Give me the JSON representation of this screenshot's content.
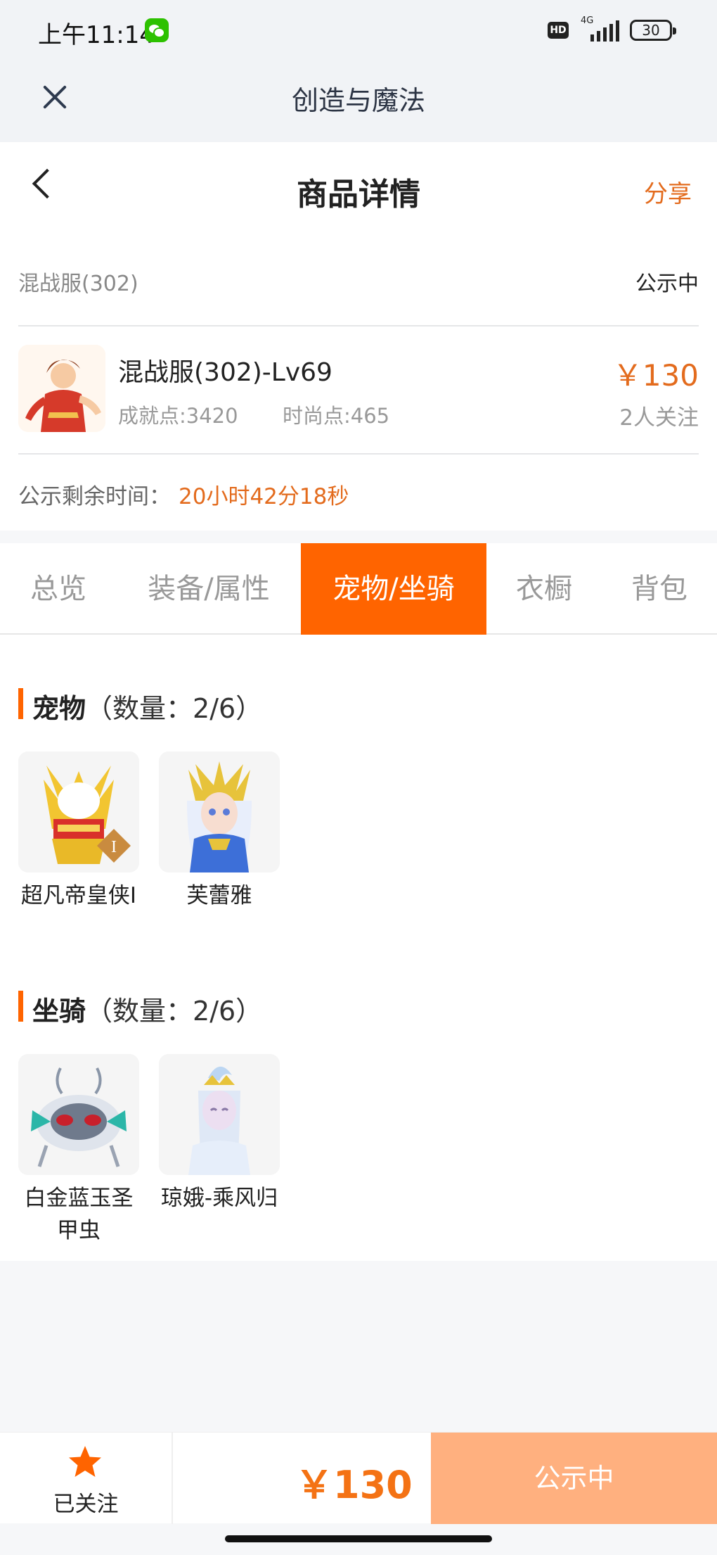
{
  "status_bar": {
    "time": "上午11:14",
    "hd": "HD",
    "network": "4G",
    "battery": "30"
  },
  "app_bar": {
    "title": "创造与魔法"
  },
  "header": {
    "title": "商品详情",
    "share_label": "分享"
  },
  "listing": {
    "server": "混战服(302)",
    "status": "公示中",
    "character_name": "混战服(302)-Lv69",
    "achievement_points": "成就点:3420",
    "fashion_points": "时尚点:465",
    "price": "￥130",
    "watchers": "2人关注",
    "timer_label": "公示剩余时间：",
    "timer_value": "20小时42分18秒"
  },
  "tabs": [
    {
      "label": "总览",
      "active": false
    },
    {
      "label": "装备/属性",
      "active": false
    },
    {
      "label": "宠物/坐骑",
      "active": true
    },
    {
      "label": "衣橱",
      "active": false
    },
    {
      "label": "背包",
      "active": false
    }
  ],
  "pets": {
    "title": "宠物",
    "count": "（数量：2/6）",
    "items": [
      {
        "name": "超凡帝皇侠Ⅰ"
      },
      {
        "name": "芙蕾雅"
      }
    ]
  },
  "mounts": {
    "title": "坐骑",
    "count": "（数量：2/6）",
    "items": [
      {
        "name": "白金蓝玉圣甲虫"
      },
      {
        "name": "琼娥-乘风归"
      }
    ]
  },
  "bottom_bar": {
    "follow_label": "已关注",
    "price": "￥130",
    "status_button": "公示中"
  },
  "colors": {
    "accent": "#ff6400",
    "price": "#e36b1d",
    "button_disabled": "#ffb07f"
  }
}
